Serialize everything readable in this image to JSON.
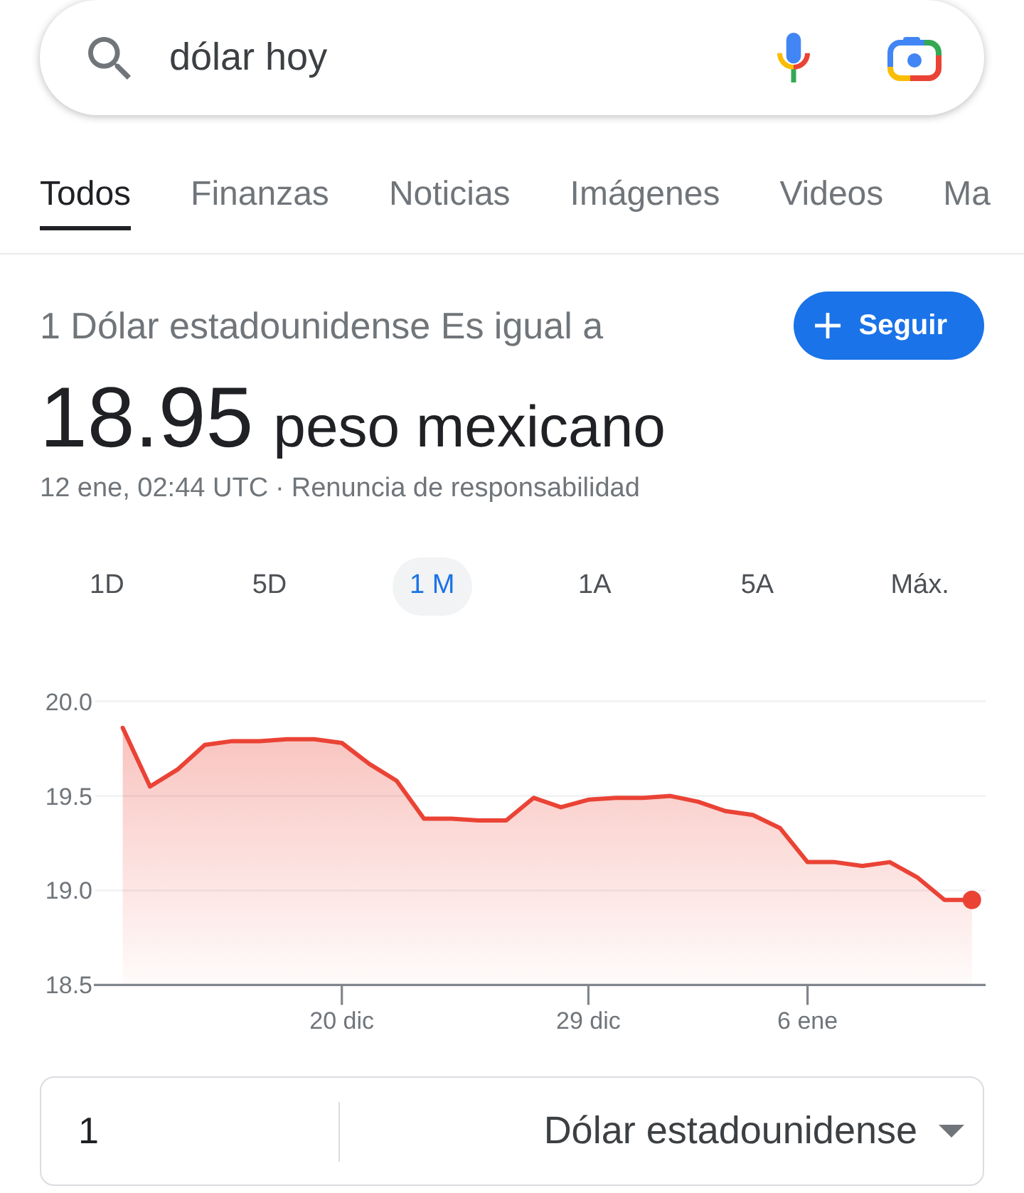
{
  "search": {
    "query": "dólar hoy"
  },
  "tabs": [
    {
      "label": "Todos",
      "selected": true
    },
    {
      "label": "Finanzas",
      "selected": false
    },
    {
      "label": "Noticias",
      "selected": false
    },
    {
      "label": "Imágenes",
      "selected": false
    },
    {
      "label": "Videos",
      "selected": false
    },
    {
      "label": "Ma",
      "selected": false
    }
  ],
  "conversion": {
    "heading": "1 Dólar estadounidense Es igual a",
    "follow_button": {
      "label": "Seguir"
    },
    "rate": "18.95",
    "currency": "peso mexicano",
    "timestamp": "12 ene, 02:44 UTC",
    "separator": "·",
    "disclaimer": "Renuncia de responsabilidad"
  },
  "ranges": [
    {
      "label": "1D",
      "selected": false
    },
    {
      "label": "5D",
      "selected": false
    },
    {
      "label": "1 M",
      "selected": true
    },
    {
      "label": "1A",
      "selected": false
    },
    {
      "label": "5A",
      "selected": false
    },
    {
      "label": "Máx.",
      "selected": false
    }
  ],
  "chart": {
    "chart_data": {
      "type": "area",
      "categories": [
        null,
        null,
        null,
        null,
        null,
        null,
        null,
        null,
        "20 dic",
        null,
        null,
        null,
        null,
        null,
        null,
        null,
        null,
        "29 dic",
        null,
        null,
        null,
        null,
        null,
        null,
        null,
        "6 ene",
        null,
        null,
        null,
        null,
        null,
        null
      ],
      "series": [
        {
          "color": "#ea4335",
          "values": [
            19.86,
            19.55,
            19.64,
            19.77,
            19.79,
            19.79,
            19.8,
            19.8,
            19.78,
            19.67,
            19.58,
            19.38,
            19.38,
            19.37,
            19.37,
            19.49,
            19.44,
            19.48,
            19.49,
            19.49,
            19.5,
            19.47,
            19.42,
            19.4,
            19.33,
            19.15,
            19.15,
            19.13,
            19.15,
            19.07,
            18.95,
            18.95
          ]
        }
      ],
      "ylim": [
        18.5,
        20
      ],
      "yticks": [
        18.5,
        {
          "value": 19,
          "label": "19.0"
        },
        19.5,
        {
          "value": 20,
          "label": "20.0"
        }
      ]
    }
  },
  "converter": {
    "amount": "1",
    "currency": "Dólar estadounidense"
  }
}
